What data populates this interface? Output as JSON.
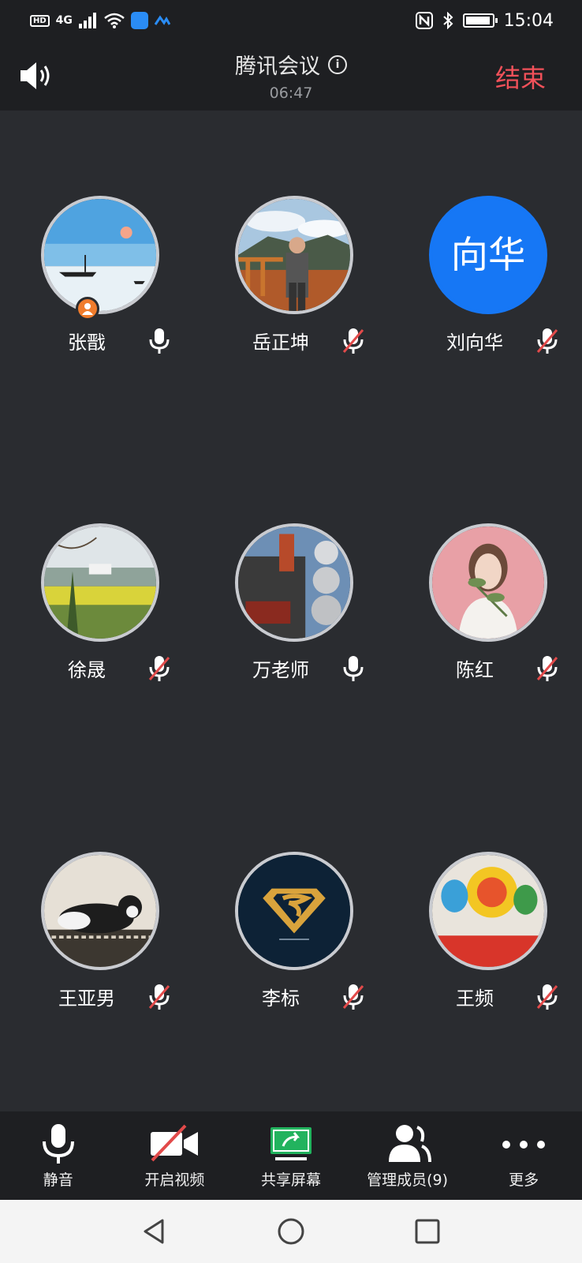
{
  "status_bar": {
    "network": "4G",
    "hd": "HD",
    "time": "15:04"
  },
  "header": {
    "title": "腾讯会议",
    "timer": "06:47",
    "end_label": "结束"
  },
  "participants": [
    {
      "name": "张戬",
      "mic": "on",
      "host": true,
      "avatar": "sunset-boat"
    },
    {
      "name": "岳正坤",
      "mic": "muted",
      "host": false,
      "avatar": "man-mountain"
    },
    {
      "name": "刘向华",
      "mic": "muted",
      "host": false,
      "avatar": "text",
      "avatar_text": "向华"
    },
    {
      "name": "徐晟",
      "mic": "muted",
      "host": false,
      "avatar": "village"
    },
    {
      "name": "万老师",
      "mic": "on",
      "host": false,
      "avatar": "street"
    },
    {
      "name": "陈红",
      "mic": "muted",
      "host": false,
      "avatar": "woman-flower"
    },
    {
      "name": "王亚男",
      "mic": "muted",
      "host": false,
      "avatar": "cat"
    },
    {
      "name": "李标",
      "mic": "muted",
      "host": false,
      "avatar": "superman"
    },
    {
      "name": "王频",
      "mic": "muted",
      "host": false,
      "avatar": "wuhan-flower"
    }
  ],
  "toolbar": {
    "mute_label": "静音",
    "video_label": "开启视频",
    "share_label": "共享屏幕",
    "members_label": "管理成员(9)",
    "more_label": "更多"
  },
  "colors": {
    "background": "#2a2c30",
    "bar": "#1e1f22",
    "end_red": "#f2515a",
    "share_green": "#22b35e",
    "host_orange": "#f07c2c",
    "avatar_blue": "#1677f5"
  }
}
